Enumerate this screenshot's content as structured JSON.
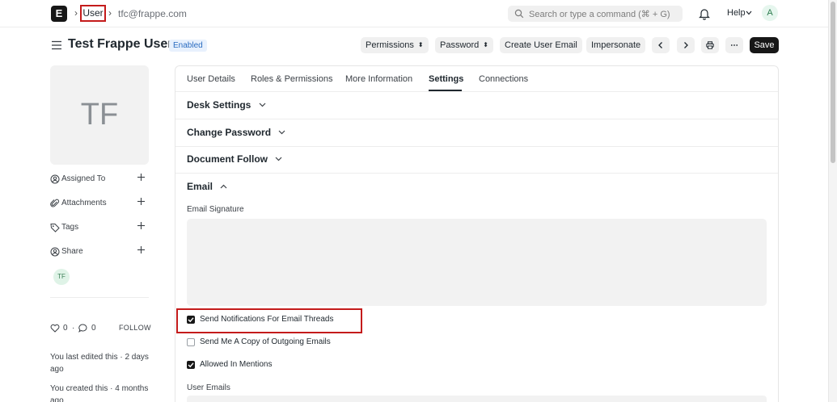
{
  "navbar": {
    "logo_letter": "E",
    "breadcrumb_current": "User",
    "breadcrumb_doc": "tfc@frappe.com",
    "search_placeholder": "Search or type a command (⌘ + G)",
    "help_label": "Help",
    "avatar_initial": "A"
  },
  "page": {
    "title": "Test Frappe User",
    "status": "Enabled",
    "actions": {
      "permissions": "Permissions",
      "password": "Password",
      "create_user_email": "Create User Email",
      "impersonate": "Impersonate",
      "save": "Save"
    }
  },
  "sidebar": {
    "avatar_initials": "TF",
    "items": [
      {
        "label": "Assigned To",
        "icon": "assign-icon"
      },
      {
        "label": "Attachments",
        "icon": "paperclip-icon"
      },
      {
        "label": "Tags",
        "icon": "tag-icon"
      },
      {
        "label": "Share",
        "icon": "share-icon"
      }
    ],
    "shared_with_initials": "TF",
    "likes": "0",
    "comments": "0",
    "follow_label": "FOLLOW",
    "last_edited": "You last edited this · 2 days ago",
    "created": "You created this · 4 months ago"
  },
  "tabs": [
    {
      "label": "User Details",
      "active": false
    },
    {
      "label": "Roles & Permissions",
      "active": false
    },
    {
      "label": "More Information",
      "active": false
    },
    {
      "label": "Settings",
      "active": true
    },
    {
      "label": "Connections",
      "active": false
    }
  ],
  "sections": {
    "desk_settings": "Desk Settings",
    "change_password": "Change Password",
    "document_follow": "Document Follow",
    "email": "Email"
  },
  "email": {
    "signature_label": "Email Signature",
    "signature_value": "",
    "checks": [
      {
        "label": "Send Notifications For Email Threads",
        "checked": true
      },
      {
        "label": "Send Me A Copy of Outgoing Emails",
        "checked": false
      },
      {
        "label": "Allowed In Mentions",
        "checked": true
      }
    ],
    "user_emails_label": "User Emails"
  },
  "colors": {
    "accent": "#171717",
    "highlight": "#c41b1b",
    "badge_bg": "#e8f1fd",
    "badge_text": "#2b6cc0"
  }
}
